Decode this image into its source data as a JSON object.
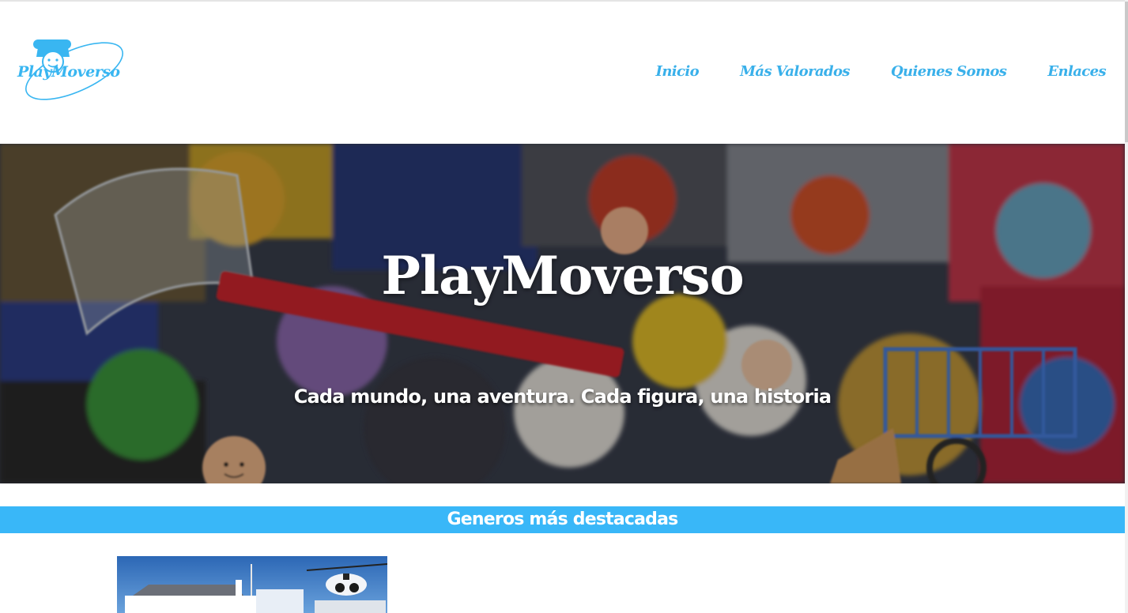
{
  "brand": {
    "logo_text": "PlayMoverso",
    "accent_color": "#39b6f1"
  },
  "nav": {
    "items": [
      {
        "label": "Inicio"
      },
      {
        "label": "Más Valorados"
      },
      {
        "label": "Quienes Somos"
      },
      {
        "label": "Enlaces"
      }
    ]
  },
  "hero": {
    "title": "PlayMoverso",
    "subtitle": "Cada mundo, una aventura. Cada figura, una historia",
    "background": "playmobil-toys-photo"
  },
  "section": {
    "title": "Generos más destacadas",
    "bar_color": "#39b7f8"
  },
  "card": {
    "image": "police-station-playset-photo"
  }
}
